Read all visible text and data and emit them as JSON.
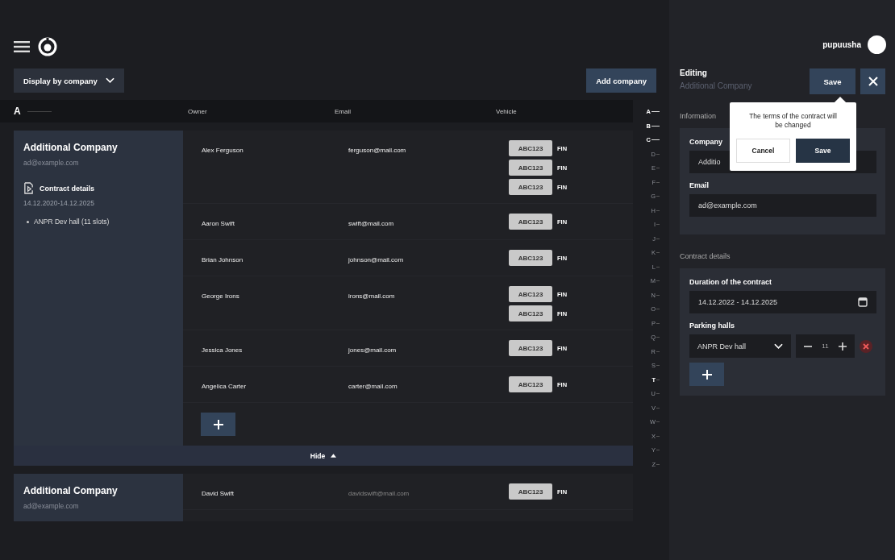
{
  "header": {
    "username": "pupuusha"
  },
  "toolbar": {
    "display_select": "Display by company",
    "add_button": "Add company"
  },
  "table": {
    "group_letter": "A",
    "columns": [
      "Owner",
      "Email",
      "Vehicle"
    ]
  },
  "companies": [
    {
      "name": "Additional Company",
      "email": "ad@example.com",
      "expanded": true,
      "contract_title": "Contract details",
      "contract_dates": "14.12.2020-14.12.2025",
      "halls": [
        "ANPR Dev hall (11 slots)"
      ],
      "owners": [
        {
          "name": "Alex Ferguson",
          "email": "ferguson@mail.com",
          "vehicles": [
            {
              "plate": "ABC123",
              "country": "FIN"
            },
            {
              "plate": "ABC123",
              "country": "FIN"
            },
            {
              "plate": "ABC123",
              "country": "FIN"
            }
          ]
        },
        {
          "name": "Aaron Swift",
          "email": "swift@mail.com",
          "vehicles": [
            {
              "plate": "ABC123",
              "country": "FIN"
            }
          ]
        },
        {
          "name": "Brian Johnson",
          "email": "johnson@mail.com",
          "vehicles": [
            {
              "plate": "ABC123",
              "country": "FIN"
            }
          ]
        },
        {
          "name": "George Irons",
          "email": "irons@mail.com",
          "vehicles": [
            {
              "plate": "ABC123",
              "country": "FIN"
            },
            {
              "plate": "ABC123",
              "country": "FIN"
            }
          ]
        },
        {
          "name": "Jessica Jones",
          "email": "jones@mail.com",
          "vehicles": [
            {
              "plate": "ABC123",
              "country": "FIN"
            }
          ]
        },
        {
          "name": "Angelica Carter",
          "email": "carter@mail.com",
          "vehicles": [
            {
              "plate": "ABC123",
              "country": "FIN"
            }
          ]
        }
      ],
      "hide_label": "Hide"
    },
    {
      "name": "Additional Company",
      "email": "ad@example.com",
      "expanded": false,
      "owners": [
        {
          "name": "David Swift",
          "email": "davidswift@mail.com",
          "vehicles": [
            {
              "plate": "ABC123",
              "country": "FIN"
            }
          ]
        }
      ]
    }
  ],
  "alphabet": [
    {
      "letter": "A",
      "active": true
    },
    {
      "letter": "B",
      "active": true
    },
    {
      "letter": "C",
      "active": true
    },
    {
      "letter": "D",
      "active": false
    },
    {
      "letter": "E",
      "active": false
    },
    {
      "letter": "F",
      "active": false
    },
    {
      "letter": "G",
      "active": false
    },
    {
      "letter": "H",
      "active": false
    },
    {
      "letter": "I",
      "active": false
    },
    {
      "letter": "J",
      "active": false
    },
    {
      "letter": "K",
      "active": false
    },
    {
      "letter": "L",
      "active": false
    },
    {
      "letter": "M",
      "active": false
    },
    {
      "letter": "N",
      "active": false
    },
    {
      "letter": "O",
      "active": false
    },
    {
      "letter": "P",
      "active": false
    },
    {
      "letter": "Q",
      "active": false
    },
    {
      "letter": "R",
      "active": false
    },
    {
      "letter": "S",
      "active": false
    },
    {
      "letter": "T",
      "active": true
    },
    {
      "letter": "U",
      "active": false
    },
    {
      "letter": "V",
      "active": false
    },
    {
      "letter": "W",
      "active": false
    },
    {
      "letter": "X",
      "active": false
    },
    {
      "letter": "Y",
      "active": false
    },
    {
      "letter": "Z",
      "active": false
    }
  ],
  "editor": {
    "title": "Editing",
    "subtitle": "Additional Company",
    "save_button": "Save",
    "information_heading": "Information",
    "company_label": "Company",
    "company_value": "Additio",
    "email_label": "Email",
    "email_value": "ad@example.com",
    "contract_heading": "Contract details",
    "duration_label": "Duration of the contract",
    "duration_value": "14.12.2022 - 14.12.2025",
    "halls_label": "Parking halls",
    "halls": [
      {
        "hall": "ANPR Dev hall",
        "slots": "11"
      }
    ]
  },
  "confirm_popover": {
    "message": "The terms of the contract will be changed",
    "cancel_button": "Cancel",
    "save_button": "Save"
  }
}
